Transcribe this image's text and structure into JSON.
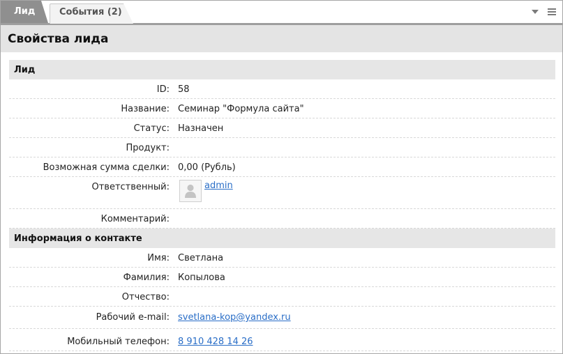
{
  "tabs": [
    {
      "label": "Лид",
      "active": true
    },
    {
      "label": "События (2)",
      "active": false
    }
  ],
  "tools": {
    "dropdown_icon": "chevron-down-icon",
    "menu_icon": "hamburger-icon"
  },
  "page_title": "Свойства лида",
  "sections": {
    "lead": {
      "title": "Лид",
      "rows": {
        "id": {
          "label": "ID:",
          "value": "58"
        },
        "name": {
          "label": "Название:",
          "value": "Семинар \"Формула сайта\""
        },
        "status": {
          "label": "Статус:",
          "value": "Назначен"
        },
        "product": {
          "label": "Продукт:",
          "value": ""
        },
        "amount": {
          "label": "Возможная сумма сделки:",
          "value": "0,00 (Рубль)"
        },
        "responsible": {
          "label": "Ответственный:",
          "value": "admin"
        },
        "comment": {
          "label": "Комментарий:",
          "value": ""
        }
      }
    },
    "contact": {
      "title": "Информация о контакте",
      "rows": {
        "first_name": {
          "label": "Имя:",
          "value": "Светлана"
        },
        "last_name": {
          "label": "Фамилия:",
          "value": "Копылова"
        },
        "patronymic": {
          "label": "Отчество:",
          "value": ""
        },
        "work_email": {
          "label": "Рабочий e-mail:",
          "value": "svetlana-kop@yandex.ru"
        },
        "mobile": {
          "label": "Мобильный телефон:",
          "value": "8 910 428 14 26"
        }
      }
    }
  },
  "colors": {
    "link": "#2a6ec7",
    "tab_active": "#8f8f8f",
    "section_bg": "#e6e6e6",
    "title_bg": "#e4e4e4"
  }
}
